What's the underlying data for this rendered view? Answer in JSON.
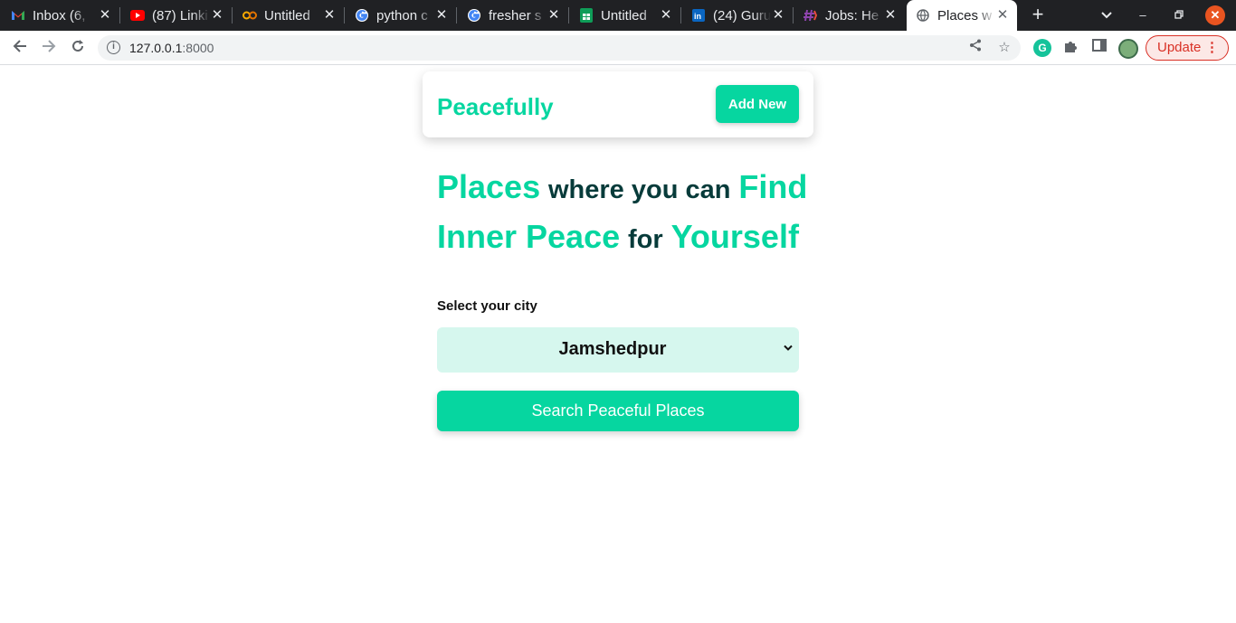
{
  "browser": {
    "tabs": [
      {
        "title": "Inbox (6,",
        "icon": "gmail-icon"
      },
      {
        "title": "(87) Linki",
        "icon": "youtube-icon"
      },
      {
        "title": "Untitled",
        "icon": "colab-icon"
      },
      {
        "title": "python c",
        "icon": "google-icon"
      },
      {
        "title": "fresher s",
        "icon": "google-icon"
      },
      {
        "title": "Untitled",
        "icon": "sheets-icon"
      },
      {
        "title": "(24) Guru",
        "icon": "linkedin-icon"
      },
      {
        "title": "Jobs: He",
        "icon": "hackerearth-icon"
      },
      {
        "title": "Places w",
        "icon": "globe-icon"
      }
    ],
    "url_host": "127.0.0.1",
    "url_port": ":8000",
    "update_label": "Update"
  },
  "navbar": {
    "brand": "Peacefully",
    "add_new_label": "Add New"
  },
  "hero": {
    "w1": "Places",
    "w2": "where you can",
    "w3": "Find",
    "w4": "Inner Peace",
    "w5": "for",
    "w6": "Yourself"
  },
  "form": {
    "city_label": "Select your city",
    "city_selected": "Jamshedpur",
    "search_label": "Search Peaceful Places"
  },
  "colors": {
    "accent": "#06d6a0",
    "heading_dark": "#073b3a",
    "select_bg": "#d6f7ee"
  }
}
